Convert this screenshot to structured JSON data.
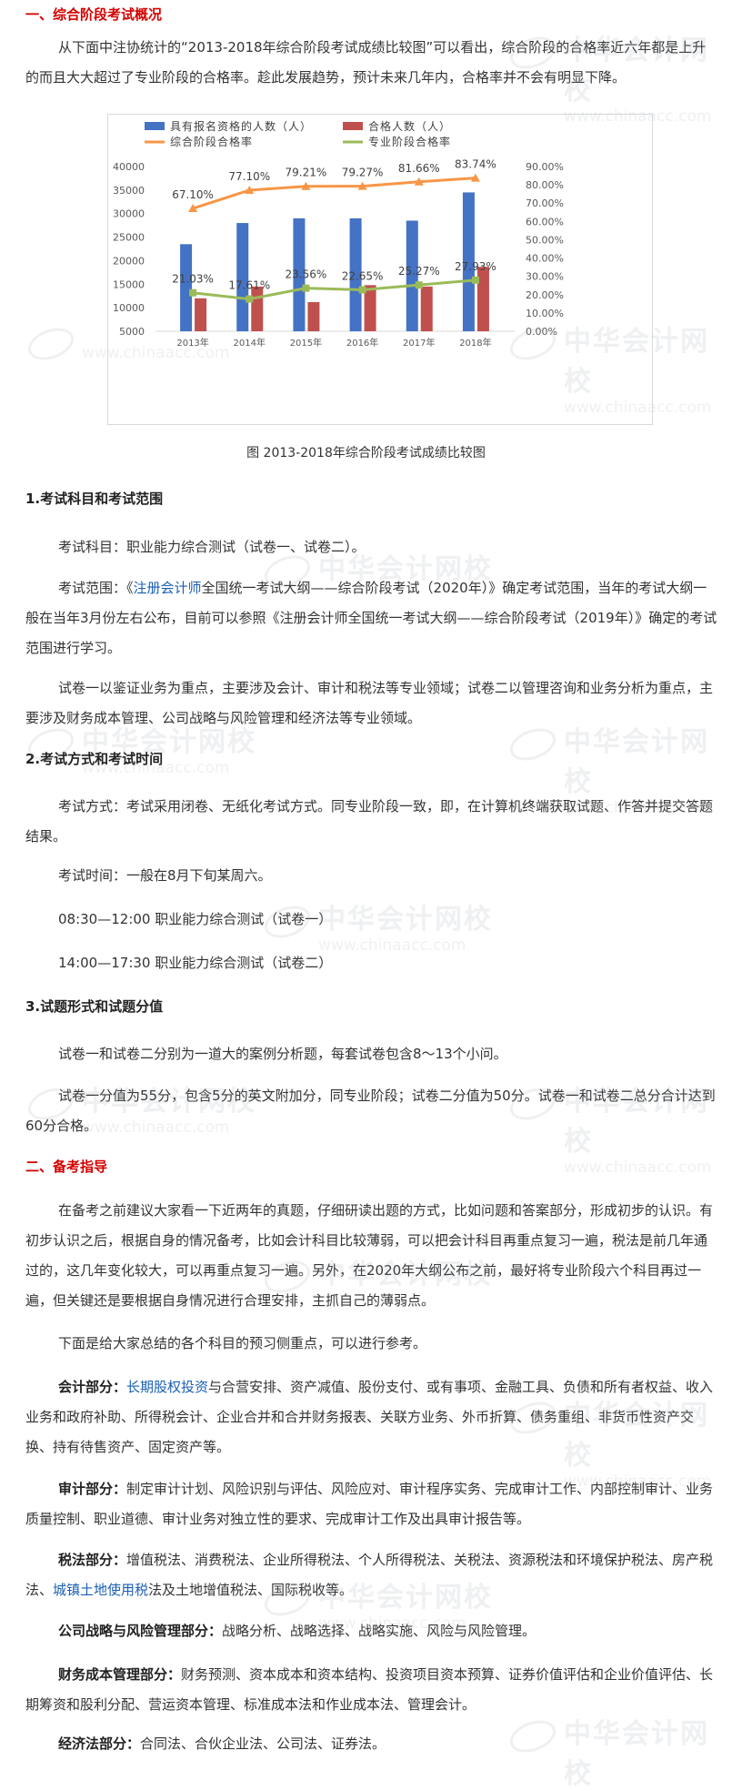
{
  "section1": {
    "heading": "一、综合阶段考试概况",
    "intro": "从下面中注协统计的“2013-2018年综合阶段考试成绩比较图”可以看出，综合阶段的合格率近六年都是上升的而且大大超过了专业阶段的合格率。趁此发展趋势，预计未来几年内，合格率并不会有明显下降。"
  },
  "chart_data": {
    "type": "bar",
    "categories": [
      "2013年",
      "2014年",
      "2015年",
      "2016年",
      "2017年",
      "2018年"
    ],
    "series": [
      {
        "name": "具有报名资格的人数（人）",
        "kind": "bar",
        "axis": "left",
        "values": [
          23500,
          28000,
          29000,
          29000,
          28500,
          34500
        ]
      },
      {
        "name": "合格人数（人）",
        "kind": "bar",
        "axis": "left",
        "values": [
          12000,
          14500,
          11200,
          14800,
          14500,
          18700
        ]
      },
      {
        "name": "综合阶段合格率",
        "kind": "line",
        "axis": "right",
        "values": [
          67.1,
          77.1,
          79.21,
          79.27,
          81.66,
          83.74
        ],
        "labels": [
          "67.10%",
          "77.10%",
          "79.21%",
          "79.27%",
          "81.66%",
          "83.74%"
        ]
      },
      {
        "name": "专业阶段合格率",
        "kind": "line",
        "axis": "right",
        "values": [
          21.03,
          17.61,
          23.56,
          22.65,
          25.27,
          27.93
        ],
        "labels": [
          "21.03%",
          "17.61%",
          "23.56%",
          "22.65%",
          "25.27%",
          "27.93%"
        ]
      }
    ],
    "left_ticks": [
      "40000",
      "35000",
      "30000",
      "25000",
      "20000",
      "15000",
      "10000",
      "5000"
    ],
    "right_ticks": [
      "90.00%",
      "80.00%",
      "70.00%",
      "60.00%",
      "50.00%",
      "40.00%",
      "30.00%",
      "20.00%",
      "10.00%",
      "0.00%"
    ],
    "ylim_left": [
      5000,
      40000
    ],
    "ylim_right": [
      0,
      90
    ],
    "legend_position": "top",
    "caption": "图 2013-2018年综合阶段考试成绩比较图",
    "colors": {
      "bar1": "#4472c4",
      "bar2": "#c0504d",
      "line1": "#f79646",
      "line2": "#9bbb59"
    }
  },
  "sub1": {
    "heading": "1.考试科目和考试范围",
    "subjects": "考试科目：职业能力综合测试（试卷一、试卷二）。",
    "scope_pre": "考试范围：《",
    "scope_link": "注册会计师",
    "scope_post": "全国统一考试大纲——综合阶段考试（2020年）》确定考试范围，当年的考试大纲一般在当年3月份左右公布，目前可以参照《注册会计师全国统一考试大纲——综合阶段考试（2019年）》确定的考试范围进行学习。",
    "papers": "试卷一以鉴证业务为重点，主要涉及会计、审计和税法等专业领域；试卷二以管理咨询和业务分析为重点，主要涉及财务成本管理、公司战略与风险管理和经济法等专业领域。"
  },
  "sub2": {
    "heading": "2.考试方式和考试时间",
    "method": "考试方式：考试采用闭卷、无纸化考试方式。同专业阶段一致，即，在计算机终端获取试题、作答并提交答题结果。",
    "time": "考试时间：一般在8月下旬某周六。",
    "slot1": "08:30—12:00 职业能力综合测试（试卷一）",
    "slot2": "14:00—17:30 职业能力综合测试（试卷二）"
  },
  "sub3": {
    "heading": "3.试题形式和试题分值",
    "form": "试卷一和试卷二分别为一道大的案例分析题，每套试卷包含8～13个小问。",
    "score": "试卷一分值为55分，包含5分的英文附加分，同专业阶段；试卷二分值为50分。试卷一和试卷二总分合计达到60分合格。"
  },
  "section2": {
    "heading": "二、备考指导",
    "advice": "在备考之前建议大家看一下近两年的真题，仔细研读出题的方式，比如问题和答案部分，形成初步的认识。有初步认识之后，根据自身的情况备考，比如会计科目比较薄弱，可以把会计科目再重点复习一遍，税法是前几年通过的，这几年变化较大，可以再重点复习一遍。另外，在2020年大纲公布之前，最好将专业阶段六个科目再过一遍，但关键还是要根据自身情况进行合理安排，主抓自己的薄弱点。",
    "summary": "下面是给大家总结的各个科目的预习侧重点，可以进行参考。",
    "acc_label": "会计部分：",
    "acc_link": "长期股权投资",
    "acc_rest": "与合营安排、资产减值、股份支付、或有事项、金融工具、负债和所有者权益、收入业务和政府补助、所得税会计、企业合并和合并财务报表、关联方业务、外币折算、债务重组、非货币性资产交换、持有待售资产、固定资产等。",
    "audit_label": "审计部分：",
    "audit_rest": "制定审计计划、风险识别与评估、风险应对、审计程序实务、完成审计工作、内部控制审计、业务质量控制、职业道德、审计业务对独立性的要求、完成审计工作及出具审计报告等。",
    "tax_label": "税法部分：",
    "tax_pre": "增值税法、消费税法、企业所得税法、个人所得税法、关税法、资源税法和环境保护税法、房产税法、",
    "tax_link": "城镇土地使用税",
    "tax_post": "法及土地增值税法、国际税收等。",
    "strat_label": "公司战略与风险管理部分：",
    "strat_rest": "战略分析、战略选择、战略实施、风险与风险管理。",
    "fin_label": "财务成本管理部分：",
    "fin_rest": "财务预测、资本成本和资本结构、投资项目资本预算、证券价值评估和企业价值评估、长期筹资和股利分配、营运资本管理、标准成本法和作业成本法、管理会计。",
    "law_label": "经济法部分：",
    "law_rest": "合同法、合伙企业法、公司法、证券法。"
  },
  "watermark": {
    "cn": "中华会计网校",
    "url": "www.chinaacc.com"
  }
}
